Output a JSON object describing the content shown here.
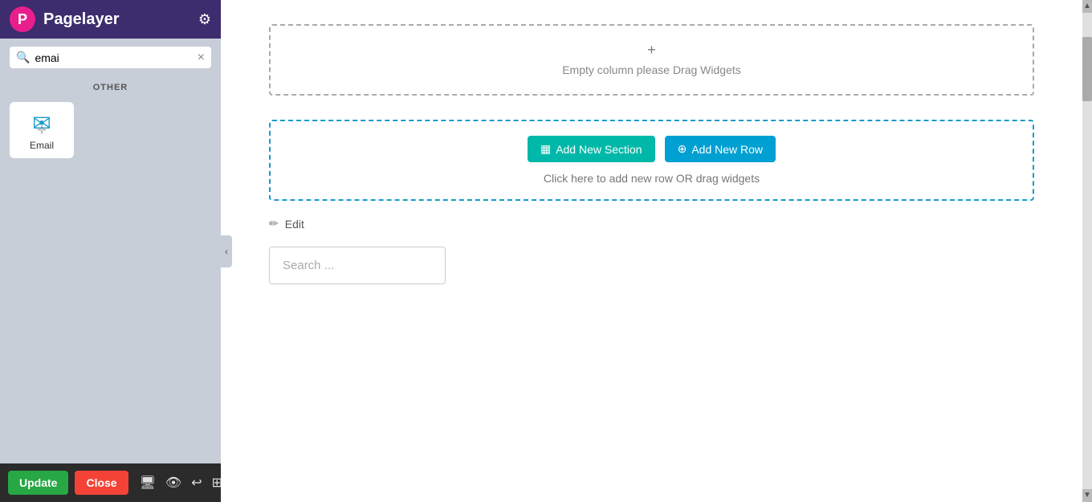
{
  "header": {
    "logo_letter": "P",
    "title": "Pagelayer",
    "gear_icon": "⚙"
  },
  "sidebar": {
    "search_placeholder": "emai",
    "clear_label": "×",
    "section_label": "OTHER",
    "widgets": [
      {
        "id": "email",
        "label": "Email",
        "icon": "✉"
      }
    ]
  },
  "bottom_bar": {
    "update_label": "Update",
    "close_label": "Close",
    "icons": [
      "🖥",
      "👁",
      "↩",
      "⊞"
    ]
  },
  "collapse": {
    "icon": "‹"
  },
  "canvas": {
    "empty_column_icon": "+",
    "empty_column_text": "Empty column please Drag Widgets",
    "add_section_label": "Add New Section",
    "add_row_label": "Add New Row",
    "click_hint": "Click here to add new row OR drag widgets",
    "edit_label": "Edit",
    "search_placeholder": "Search ..."
  },
  "scrollbar": {
    "up_arrow": "▲",
    "down_arrow": "▼"
  }
}
